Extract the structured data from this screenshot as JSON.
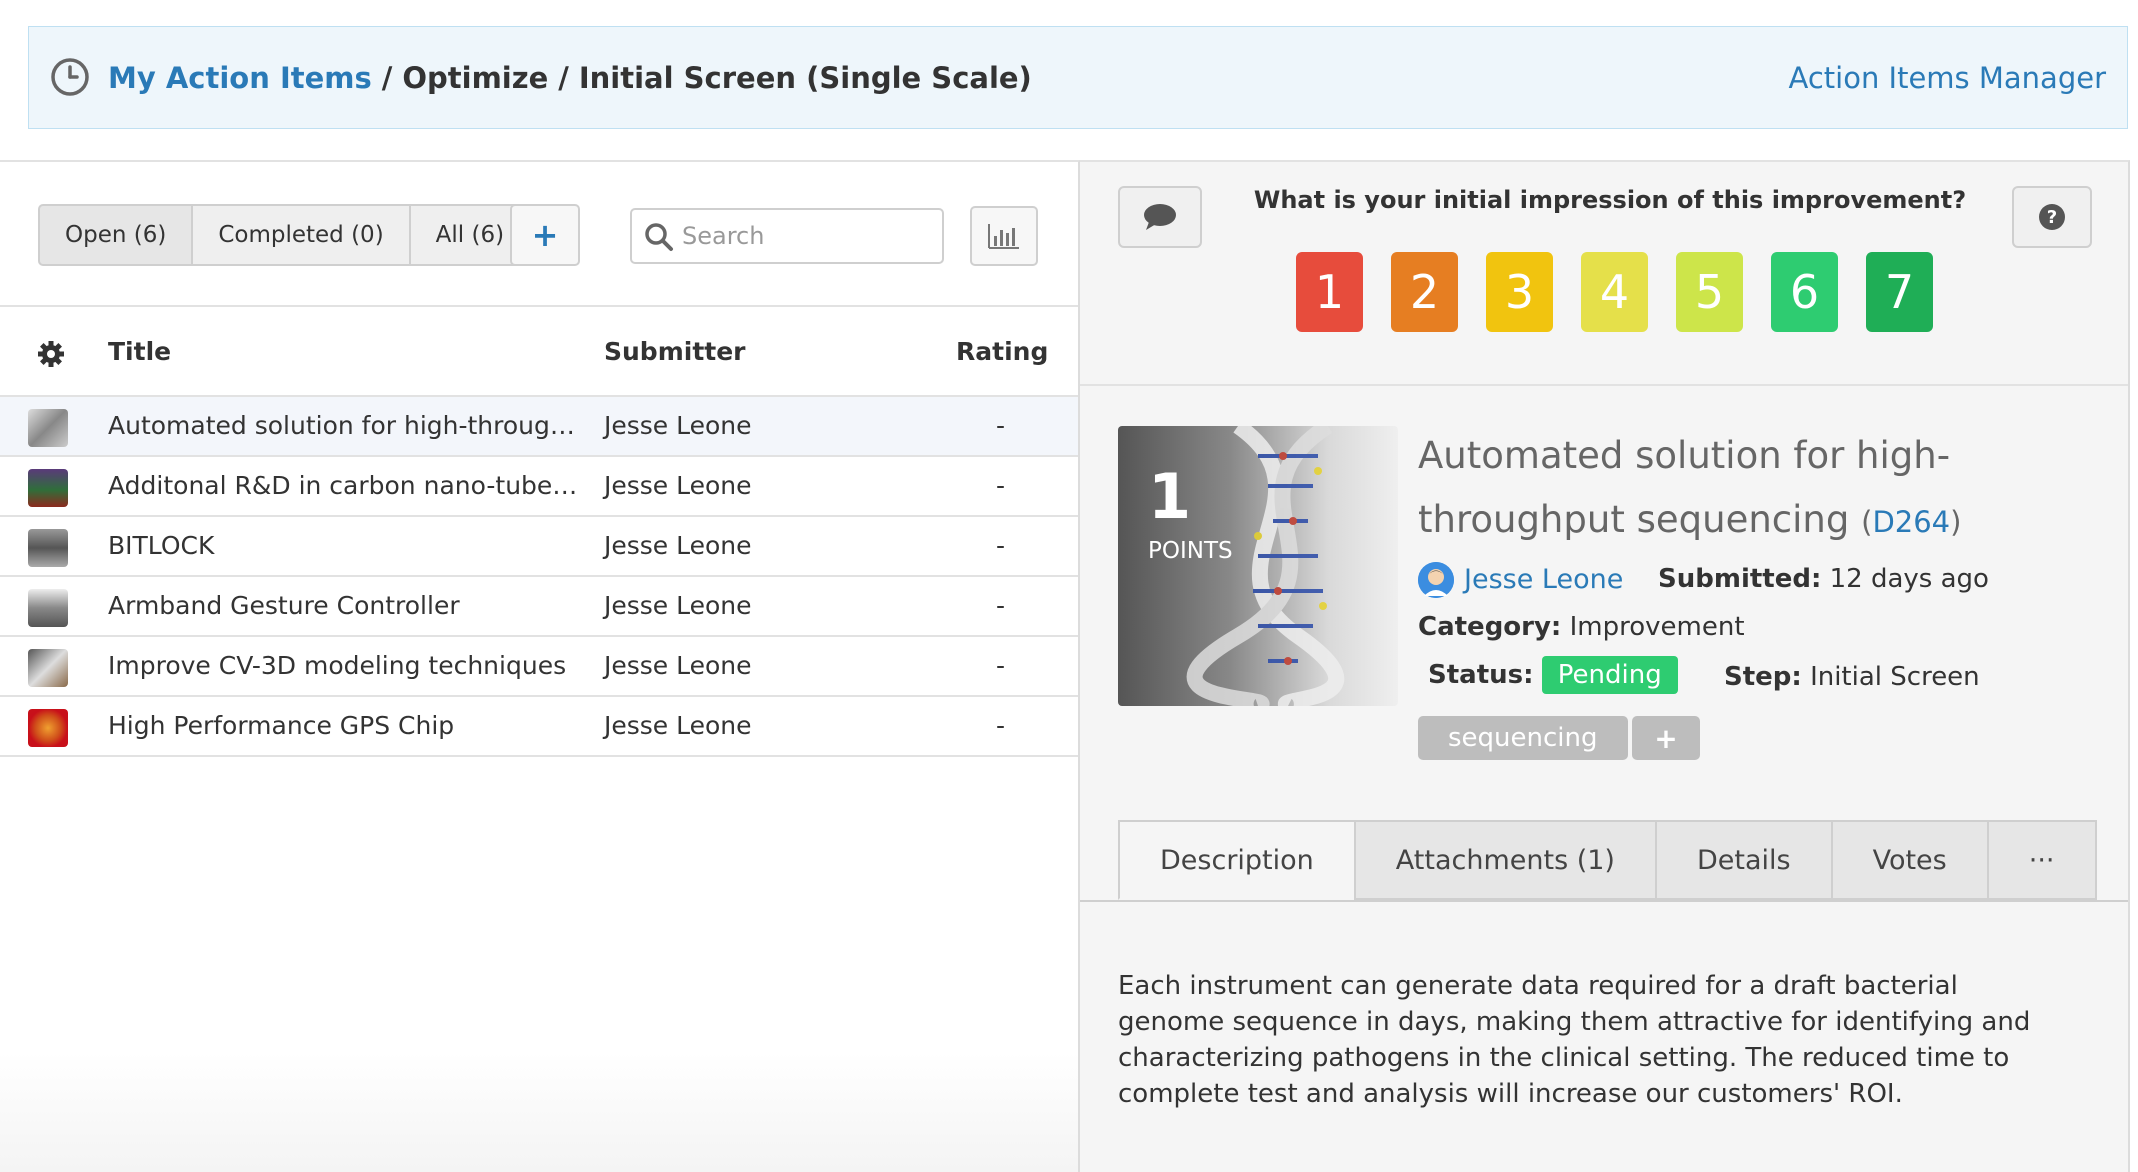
{
  "header": {
    "breadcrumb": [
      {
        "label": "My Action Items"
      },
      {
        "label": "Optimize"
      },
      {
        "label": "Initial Screen (Single Scale)"
      }
    ],
    "separator": "/",
    "manager_link": "Action Items Manager"
  },
  "toolbar": {
    "filters": [
      {
        "label": "Open (6)"
      },
      {
        "label": "Completed (0)"
      },
      {
        "label": "All (6)"
      }
    ],
    "add_label": "+",
    "search_placeholder": "Search"
  },
  "table": {
    "columns": {
      "title": "Title",
      "submitter": "Submitter",
      "rating": "Rating"
    },
    "rows": [
      {
        "title": "Automated solution for high-throughput sequencing",
        "submitter": "Jesse Leone",
        "rating": "-"
      },
      {
        "title": "Additonal R&D in carbon nano-tube technology",
        "submitter": "Jesse Leone",
        "rating": "-"
      },
      {
        "title": "BITLOCK",
        "submitter": "Jesse Leone",
        "rating": "-"
      },
      {
        "title": "Armband Gesture Controller",
        "submitter": "Jesse Leone",
        "rating": "-"
      },
      {
        "title": "Improve CV-3D modeling techniques",
        "submitter": "Jesse Leone",
        "rating": "-"
      },
      {
        "title": "High Performance GPS Chip",
        "submitter": "Jesse Leone",
        "rating": "-"
      }
    ]
  },
  "rating_panel": {
    "question": "What is your initial impression of this improvement?",
    "options": [
      {
        "label": "1",
        "color": "#e74c3c"
      },
      {
        "label": "2",
        "color": "#e67e22"
      },
      {
        "label": "3",
        "color": "#f1c40f"
      },
      {
        "label": "4",
        "color": "#e5e04a"
      },
      {
        "label": "5",
        "color": "#cde54a"
      },
      {
        "label": "6",
        "color": "#2ecc71"
      },
      {
        "label": "7",
        "color": "#1fae56"
      }
    ]
  },
  "detail": {
    "points_value": "1",
    "points_label": "POINTS",
    "title": "Automated solution for high-throughput sequencing",
    "code": "D264",
    "submitter": "Jesse Leone",
    "submitted_label": "Submitted:",
    "submitted_value": "12 days ago",
    "category_label": "Category:",
    "category_value": "Improvement",
    "status_label": "Status:",
    "status_value": "Pending",
    "step_label": "Step:",
    "step_value": "Initial Screen",
    "tag": "sequencing",
    "tag_add": "+",
    "tabs": [
      {
        "label": "Description"
      },
      {
        "label": "Attachments (1)"
      },
      {
        "label": "Details"
      },
      {
        "label": "Votes"
      },
      {
        "label": "···"
      }
    ],
    "description": "Each instrument can generate data required for a draft bacterial genome sequence in days, making them attractive for identifying and characterizing pathogens in the clinical setting.  The reduced time to complete test and analysis will increase our customers' ROI."
  },
  "colors": {
    "link": "#2a7ab7",
    "header_bg": "#eef6fb",
    "status_pending": "#2ecc71",
    "tag_bg": "#bdbdbd"
  }
}
